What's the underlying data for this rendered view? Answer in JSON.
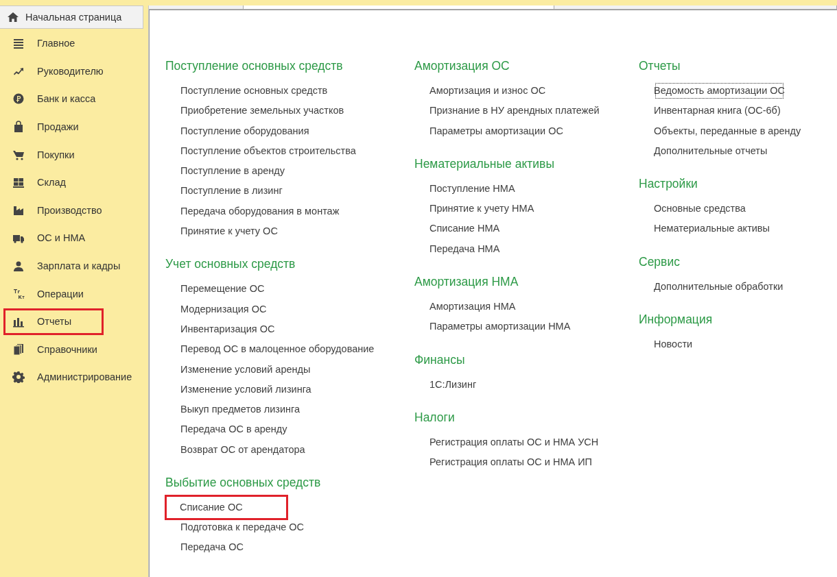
{
  "home_tab": {
    "label": "Начальная страница"
  },
  "sidebar": {
    "items": [
      {
        "label": "Главное",
        "highlighted": false
      },
      {
        "label": "Руководителю",
        "highlighted": false
      },
      {
        "label": "Банк и касса",
        "highlighted": false
      },
      {
        "label": "Продажи",
        "highlighted": false
      },
      {
        "label": "Покупки",
        "highlighted": false
      },
      {
        "label": "Склад",
        "highlighted": false
      },
      {
        "label": "Производство",
        "highlighted": false
      },
      {
        "label": "ОС и НМА",
        "highlighted": false
      },
      {
        "label": "Зарплата и кадры",
        "highlighted": false
      },
      {
        "label": "Операции",
        "highlighted": false
      },
      {
        "label": "Отчеты",
        "highlighted": true
      },
      {
        "label": "Справочники",
        "highlighted": false
      },
      {
        "label": "Администрирование",
        "highlighted": false
      }
    ]
  },
  "columns": [
    [
      {
        "heading": "Поступление основных средств",
        "links": [
          {
            "label": "Поступление основных средств",
            "highlighted": false,
            "focused": false
          },
          {
            "label": "Приобретение земельных участков",
            "highlighted": false,
            "focused": false
          },
          {
            "label": "Поступление оборудования",
            "highlighted": false,
            "focused": false
          },
          {
            "label": "Поступление объектов строительства",
            "highlighted": false,
            "focused": false
          },
          {
            "label": "Поступление в аренду",
            "highlighted": false,
            "focused": false
          },
          {
            "label": "Поступление в лизинг",
            "highlighted": false,
            "focused": false
          },
          {
            "label": "Передача оборудования в монтаж",
            "highlighted": false,
            "focused": false
          },
          {
            "label": "Принятие к учету ОС",
            "highlighted": false,
            "focused": false
          }
        ]
      },
      {
        "heading": "Учет основных средств",
        "links": [
          {
            "label": "Перемещение ОС",
            "highlighted": false,
            "focused": false
          },
          {
            "label": "Модернизация ОС",
            "highlighted": false,
            "focused": false
          },
          {
            "label": "Инвентаризация ОС",
            "highlighted": false,
            "focused": false
          },
          {
            "label": "Перевод ОС в малоценное оборудование",
            "highlighted": false,
            "focused": false
          },
          {
            "label": "Изменение условий аренды",
            "highlighted": false,
            "focused": false
          },
          {
            "label": "Изменение условий лизинга",
            "highlighted": false,
            "focused": false
          },
          {
            "label": "Выкуп предметов лизинга",
            "highlighted": false,
            "focused": false
          },
          {
            "label": "Передача ОС в аренду",
            "highlighted": false,
            "focused": false
          },
          {
            "label": "Возврат ОС от арендатора",
            "highlighted": false,
            "focused": false
          }
        ]
      },
      {
        "heading": "Выбытие основных средств",
        "links": [
          {
            "label": "Списание ОС",
            "highlighted": true,
            "focused": false
          },
          {
            "label": "Подготовка к передаче ОС",
            "highlighted": false,
            "focused": false
          },
          {
            "label": "Передача ОС",
            "highlighted": false,
            "focused": false
          }
        ]
      }
    ],
    [
      {
        "heading": "Амортизация ОС",
        "links": [
          {
            "label": "Амортизация и износ ОС",
            "highlighted": false,
            "focused": false
          },
          {
            "label": "Признание в НУ арендных платежей",
            "highlighted": false,
            "focused": false
          },
          {
            "label": "Параметры амортизации ОС",
            "highlighted": false,
            "focused": false
          }
        ]
      },
      {
        "heading": "Нематериальные активы",
        "links": [
          {
            "label": "Поступление НМА",
            "highlighted": false,
            "focused": false
          },
          {
            "label": "Принятие к учету НМА",
            "highlighted": false,
            "focused": false
          },
          {
            "label": "Списание НМА",
            "highlighted": false,
            "focused": false
          },
          {
            "label": "Передача НМА",
            "highlighted": false,
            "focused": false
          }
        ]
      },
      {
        "heading": "Амортизация НМА",
        "links": [
          {
            "label": "Амортизация НМА",
            "highlighted": false,
            "focused": false
          },
          {
            "label": "Параметры амортизации НМА",
            "highlighted": false,
            "focused": false
          }
        ]
      },
      {
        "heading": "Финансы",
        "links": [
          {
            "label": "1С:Лизинг",
            "highlighted": false,
            "focused": false
          }
        ]
      },
      {
        "heading": "Налоги",
        "links": [
          {
            "label": "Регистрация оплаты ОС и НМА УСН",
            "highlighted": false,
            "focused": false
          },
          {
            "label": "Регистрация оплаты ОС и НМА ИП",
            "highlighted": false,
            "focused": false
          }
        ]
      }
    ],
    [
      {
        "heading": "Отчеты",
        "links": [
          {
            "label": "Ведомость амортизации ОС",
            "highlighted": false,
            "focused": true
          },
          {
            "label": "Инвентарная книга (ОС-6б)",
            "highlighted": false,
            "focused": false
          },
          {
            "label": "Объекты, переданные в аренду",
            "highlighted": false,
            "focused": false
          },
          {
            "label": "Дополнительные отчеты",
            "highlighted": false,
            "focused": false
          }
        ]
      },
      {
        "heading": "Настройки",
        "links": [
          {
            "label": "Основные средства",
            "highlighted": false,
            "focused": false
          },
          {
            "label": "Нематериальные активы",
            "highlighted": false,
            "focused": false
          }
        ]
      },
      {
        "heading": "Сервис",
        "links": [
          {
            "label": "Дополнительные обработки",
            "highlighted": false,
            "focused": false
          }
        ]
      },
      {
        "heading": "Информация",
        "links": [
          {
            "label": "Новости",
            "highlighted": false,
            "focused": false
          }
        ]
      }
    ]
  ]
}
